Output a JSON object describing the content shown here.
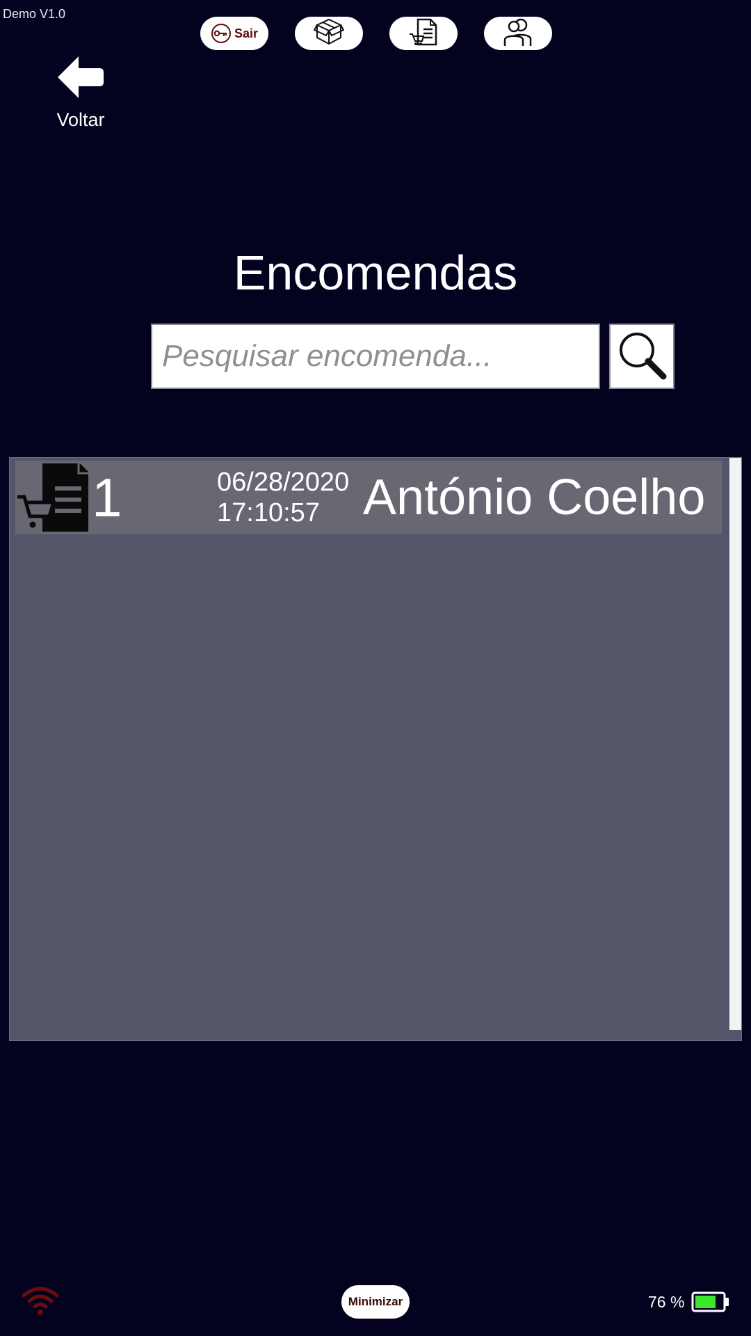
{
  "app": {
    "version": "Demo V1.0"
  },
  "top_nav": {
    "logout_label": "Sair",
    "items": [
      {
        "icon": "key-icon",
        "label": "Sair"
      },
      {
        "icon": "products-box-icon"
      },
      {
        "icon": "orders-icon"
      },
      {
        "icon": "users-icon"
      }
    ]
  },
  "back": {
    "label": "Voltar",
    "icon": "arrow-left-icon"
  },
  "page": {
    "title": "Encomendas"
  },
  "search": {
    "placeholder": "Pesquisar encomenda...",
    "value": "",
    "icon": "magnifier-icon"
  },
  "orders": [
    {
      "number": "1",
      "date": "06/28/2020",
      "time": "17:10:57",
      "customer": "António Coelho",
      "icon": "order-cart-document-icon"
    }
  ],
  "footer": {
    "minimize_label": "Minimizar",
    "battery_percent": "76 %",
    "battery_level": 0.76,
    "wifi_status": "disconnected",
    "colors": {
      "wifi": "#6e0b0b",
      "battery_fill": "#3ce62a"
    }
  },
  "colors": {
    "background": "#03021f",
    "panel": "#545569",
    "row": "#686873",
    "accent_text": "#5b0a0a"
  }
}
